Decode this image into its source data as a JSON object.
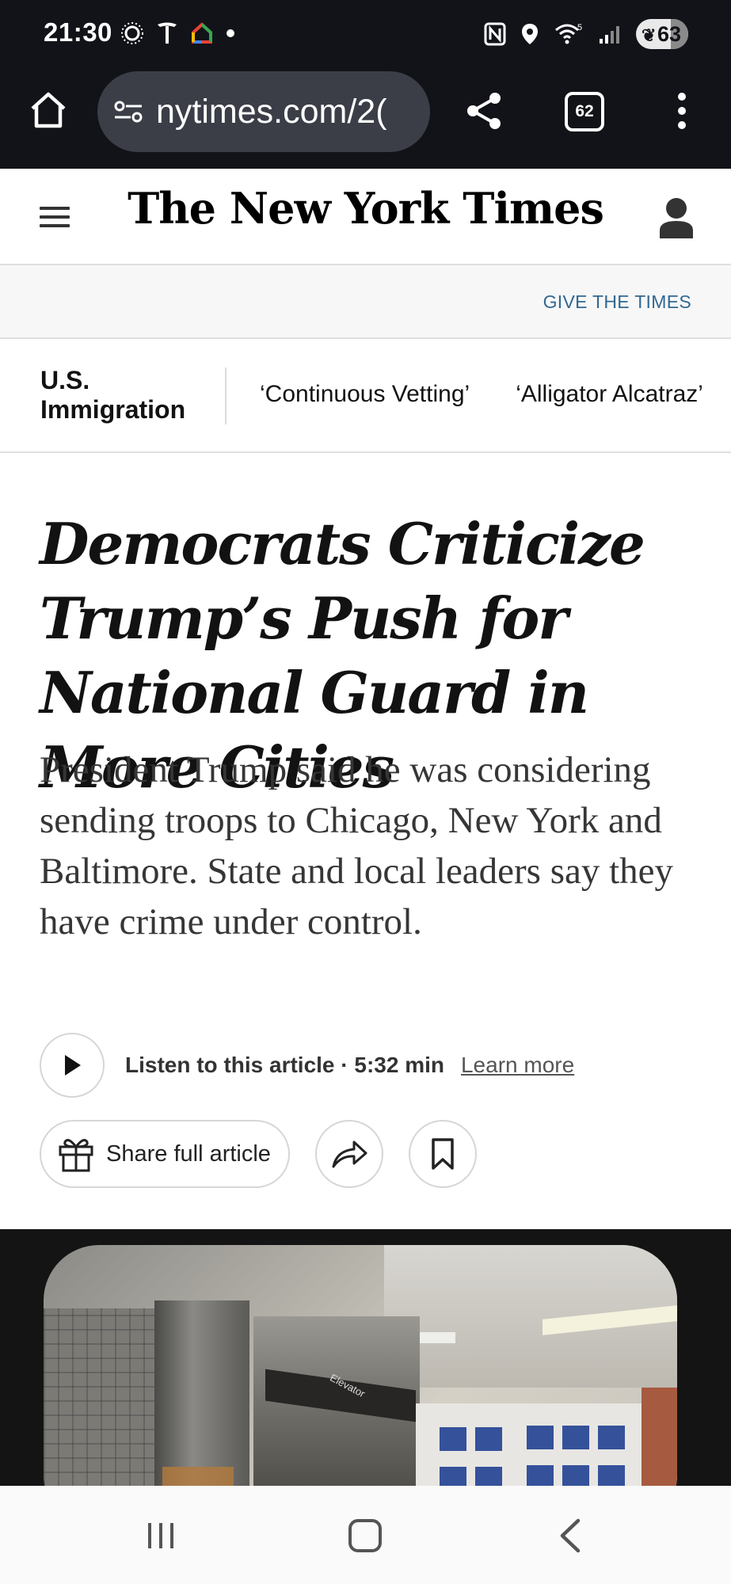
{
  "status_bar": {
    "time": "21:30",
    "battery": "63",
    "signal_label": "5"
  },
  "browser": {
    "url": "nytimes.com/2(",
    "tab_count": "62"
  },
  "masthead": {
    "logo": "The New York Times"
  },
  "banner": {
    "give_link": "GIVE THE TIMES"
  },
  "section_nav": {
    "title": "U.S. Immigration",
    "links": [
      "‘Continuous Vetting’",
      "‘Alligator Alcatraz’"
    ]
  },
  "article": {
    "headline": "Democrats Criticize Trump’s Push for National Guard in More Cities",
    "summary": "President Trump said he was considering sending troops to Chicago, New York and Baltimore. State and local leaders say they have crime under control.",
    "listen_label": "Listen to this article · 5:32 min",
    "learn_more": "Learn more",
    "share_full_label": "Share full article",
    "photo_sign_text": "Elevator"
  },
  "colors": {
    "browser_bg": "#121318",
    "url_pill": "#3b3e47",
    "link_blue": "#326891",
    "text_primary": "#121212"
  },
  "icons": {
    "home": "home-icon",
    "site_settings": "tune-icon",
    "share": "share-icon",
    "overflow": "more-vert-icon",
    "hamburger": "hamburger-icon",
    "account": "account-icon",
    "play": "play-icon",
    "gift": "gift-icon",
    "share_arrow": "share-arrow-icon",
    "bookmark": "bookmark-icon"
  }
}
